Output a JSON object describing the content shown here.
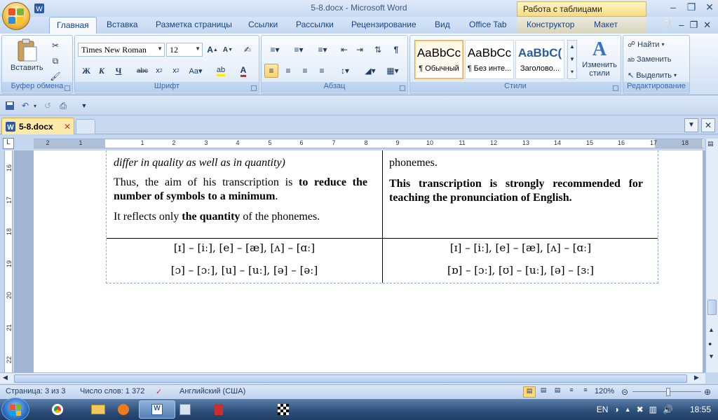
{
  "window": {
    "title": "5-8.docx - Microsoft Word",
    "context_title": "Работа с таблицами"
  },
  "tabs": [
    "Главная",
    "Вставка",
    "Разметка страницы",
    "Ссылки",
    "Рассылки",
    "Рецензирование",
    "Вид",
    "Office Tab",
    "Конструктор",
    "Макет"
  ],
  "ribbon": {
    "clipboard": {
      "label": "Буфер обмена",
      "paste": "Вставить"
    },
    "font": {
      "label": "Шрифт",
      "name": "Times New Roman",
      "size": "12"
    },
    "paragraph": {
      "label": "Абзац"
    },
    "styles": {
      "label": "Стили",
      "items": [
        {
          "sample": "AaBbCc",
          "name": "¶ Обычный"
        },
        {
          "sample": "AaBbCc",
          "name": "¶ Без инте..."
        },
        {
          "sample": "AaBbC(",
          "name": "Заголово..."
        }
      ],
      "change": "Изменить стили"
    },
    "editing": {
      "label": "Редактирование",
      "find": "Найти",
      "replace": "Заменить",
      "select": "Выделить"
    }
  },
  "doc_tab": {
    "name": "5-8.docx"
  },
  "ruler": {
    "h_numbers": [
      "2",
      "1",
      "1",
      "2",
      "3",
      "4",
      "5",
      "6",
      "7",
      "8",
      "9",
      "10",
      "11",
      "12",
      "13",
      "14",
      "15",
      "16",
      "17",
      "18"
    ],
    "v_numbers": [
      "16",
      "17",
      "18",
      "19",
      "20",
      "21",
      "22"
    ]
  },
  "document": {
    "left_partial": "differ in quality as well as in quantity)",
    "left_p1_a": "Thus, the aim of his transcription is ",
    "left_p1_b": "to reduce the number of symbols to a minimum",
    "left_p1_c": ".",
    "left_p2_a": "It reflects only ",
    "left_p2_b": "the quantity",
    "left_p2_c": " of the phonemes.",
    "right_partial": "phonemes.",
    "right_p1": "This transcription is strongly recommended for teaching the pronunciation of English.",
    "left_ipa_1": "[ɪ] – [iː], [e] – [æ], [ʌ] – [ɑː]",
    "left_ipa_2": "[ɔ] – [ɔː], [u] – [uː], [ə] – [əː]",
    "right_ipa_1": "[ɪ] – [iː], [e] – [æ], [ʌ] – [ɑː]",
    "right_ipa_2": "[ɒ] – [ɔː], [ʊ] – [uː], [ə] – [ɜː]"
  },
  "status": {
    "page": "Страница: 3 из 3",
    "words": "Число слов: 1 372",
    "language": "Английский (США)",
    "zoom": "120%"
  },
  "taskbar": {
    "lang": "EN",
    "time": "18:55"
  }
}
